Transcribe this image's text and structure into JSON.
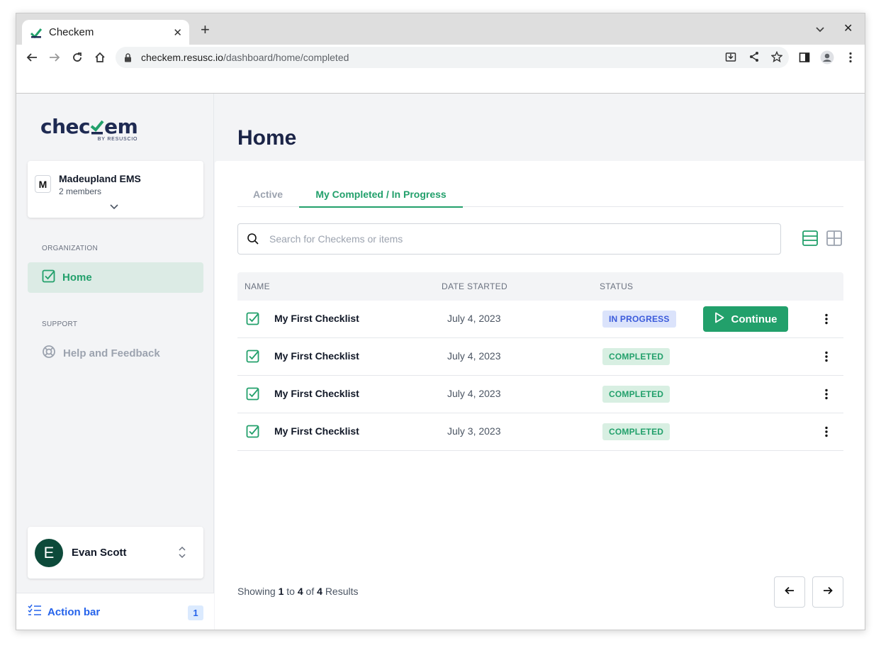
{
  "browser": {
    "tab_title": "Checkem",
    "url_host": "checkem.resusc.io",
    "url_path": "/dashboard/home/completed"
  },
  "logo": {
    "text_a": "chec",
    "text_b": "em",
    "subtitle": "BY RESUSCIO"
  },
  "org": {
    "initial": "M",
    "name": "Madeupland EMS",
    "members": "2 members"
  },
  "sidebar": {
    "section_org": "ORGANIZATION",
    "home_label": "Home",
    "section_support": "SUPPORT",
    "help_label": "Help and Feedback"
  },
  "user": {
    "initial": "E",
    "name": "Evan Scott"
  },
  "action_bar": {
    "label": "Action bar",
    "count": "1"
  },
  "page": {
    "title": "Home"
  },
  "tabs": {
    "active": "Active",
    "completed": "My Completed / In Progress"
  },
  "search": {
    "placeholder": "Search for Checkems or items"
  },
  "table": {
    "headers": [
      "NAME",
      "DATE STARTED",
      "STATUS"
    ],
    "continue_label": "Continue",
    "rows": [
      {
        "name": "My First Checklist",
        "date": "July 4, 2023",
        "status": "IN PROGRESS"
      },
      {
        "name": "My First Checklist",
        "date": "July 4, 2023",
        "status": "COMPLETED"
      },
      {
        "name": "My First Checklist",
        "date": "July 4, 2023",
        "status": "COMPLETED"
      },
      {
        "name": "My First Checklist",
        "date": "July 3, 2023",
        "status": "COMPLETED"
      }
    ]
  },
  "pagination": {
    "showing": "Showing",
    "from": "1",
    "to_word": "to",
    "to": "4",
    "of_word": "of",
    "total": "4",
    "results": "Results"
  },
  "colors": {
    "accent": "#22a06b",
    "navy": "#1b2447",
    "in_progress": "#3b5bdb"
  }
}
